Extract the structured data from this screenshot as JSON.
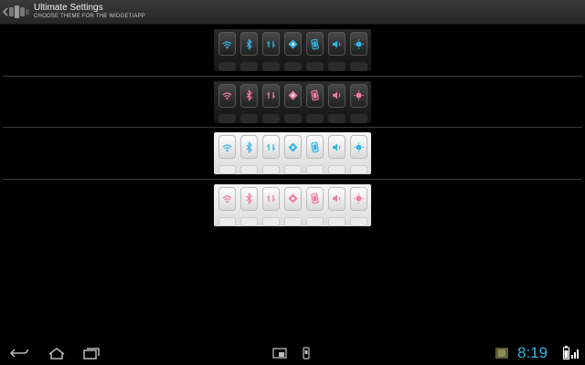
{
  "actionbar": {
    "title": "Ultimate Settings",
    "subtitle": "CHOOSE THEME FOR THE WIDGET/APP"
  },
  "themes": [
    {
      "style": "dark",
      "accent": "#33b5e5"
    },
    {
      "style": "dark",
      "accent": "#f07aa8"
    },
    {
      "style": "light",
      "accent": "#33b5e5"
    },
    {
      "style": "light",
      "accent": "#f07aa8"
    }
  ],
  "toggle_icons": [
    "wifi-icon",
    "bluetooth-icon",
    "sync-icon",
    "gps-icon",
    "screen-rotation-icon",
    "sound-icon",
    "brightness-icon"
  ],
  "systembar": {
    "clock": "8:19",
    "clock_color": "#33b5e5"
  }
}
